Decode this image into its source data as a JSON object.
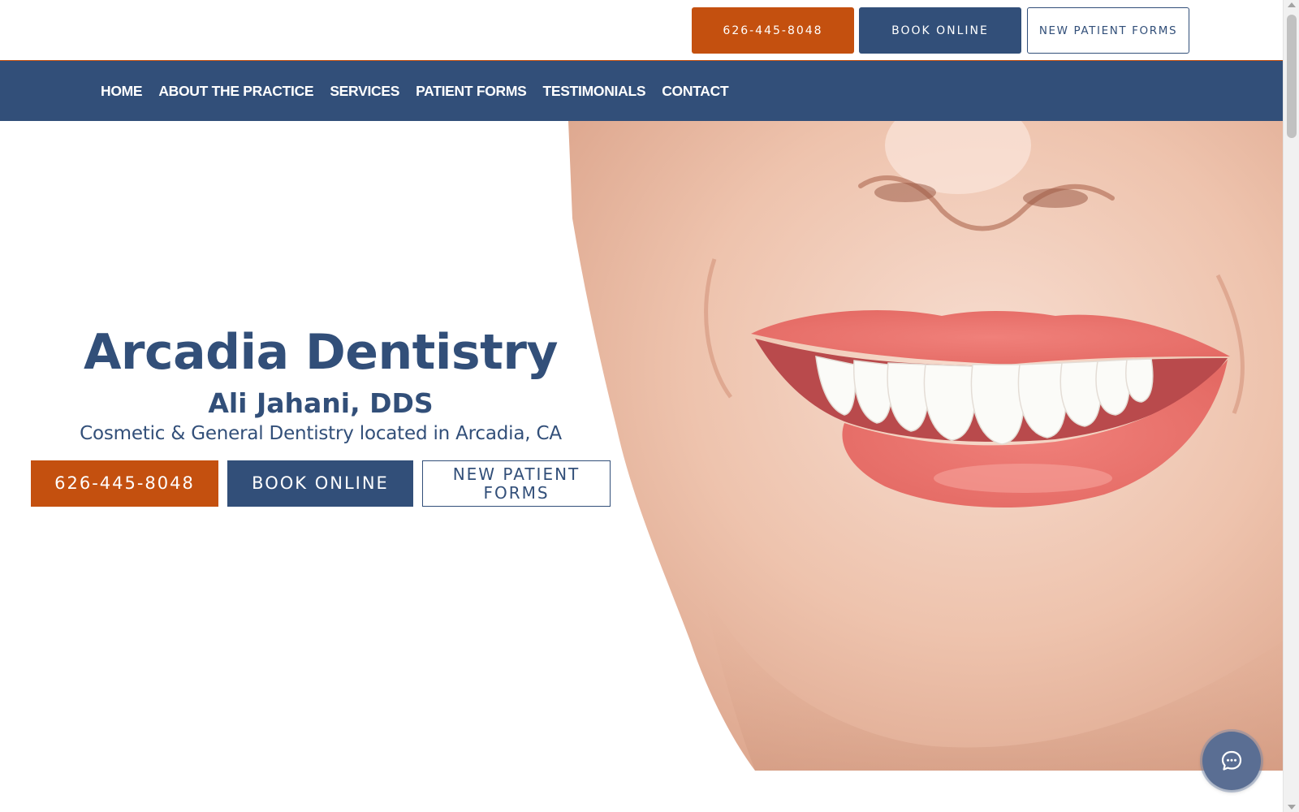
{
  "colors": {
    "brand_blue": "#324f79",
    "brand_orange": "#c4500f",
    "white": "#ffffff"
  },
  "topbar": {
    "phone_label": "626-445-8048",
    "book_label": "BOOK ONLINE",
    "forms_label": "NEW PATIENT FORMS"
  },
  "nav": {
    "items": [
      {
        "label": "HOME"
      },
      {
        "label": "ABOUT THE PRACTICE"
      },
      {
        "label": "SERVICES"
      },
      {
        "label": "PATIENT FORMS"
      },
      {
        "label": "TESTIMONIALS"
      },
      {
        "label": "CONTACT"
      }
    ]
  },
  "hero": {
    "title": "Arcadia Dentistry",
    "subtitle": "Ali Jahani, DDS",
    "tagline": "Cosmetic & General Dentistry located in Arcadia, CA",
    "phone_label": "626-445-8048",
    "book_label": "BOOK ONLINE",
    "forms_label": "NEW PATIENT FORMS",
    "image": "smiling-woman-photo"
  },
  "chat": {
    "icon": "chat-bubble-icon"
  }
}
